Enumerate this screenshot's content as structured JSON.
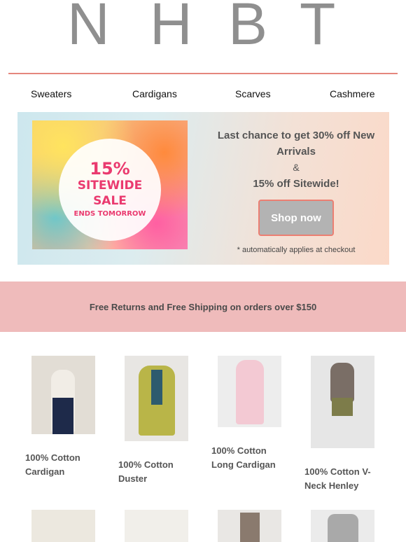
{
  "brand": {
    "logo_letters": [
      "N",
      "H",
      "B",
      "T"
    ],
    "logo_color": "#8f8f8f",
    "rule_color": "#e5877d"
  },
  "nav": {
    "items": [
      "Sweaters",
      "Cardigans",
      "Scarves",
      "Cashmere"
    ]
  },
  "hero": {
    "art": {
      "pct": "15%",
      "sale": "SITEWIDE SALE",
      "ends": "ENDS TOMORROW"
    },
    "line1": "Last chance to get 30% off New Arrivals",
    "amp": "&",
    "line2": "15% off Sitewide!",
    "cta": "Shop now",
    "note": "* automatically applies at checkout"
  },
  "banner": {
    "text": "Free Returns and Free Shipping on orders over $150",
    "bg_color": "#efbbbb"
  },
  "products": [
    {
      "name": "100% Cotton Cardigan",
      "photo_color": "#e2ddd5"
    },
    {
      "name": "100% Cotton Duster",
      "photo_color": "#b9b548"
    },
    {
      "name": "100% Cotton Long Cardigan",
      "photo_color": "#f3c9d3"
    },
    {
      "name": "100% Cotton V-Neck Henley",
      "photo_color": "#7a6e66"
    }
  ],
  "products_row2": [
    {
      "photo_color": "#ece8df"
    },
    {
      "photo_color": "#f1efea"
    },
    {
      "photo_color": "#8a7a6e"
    },
    {
      "photo_color": "#a9a9a9"
    }
  ]
}
